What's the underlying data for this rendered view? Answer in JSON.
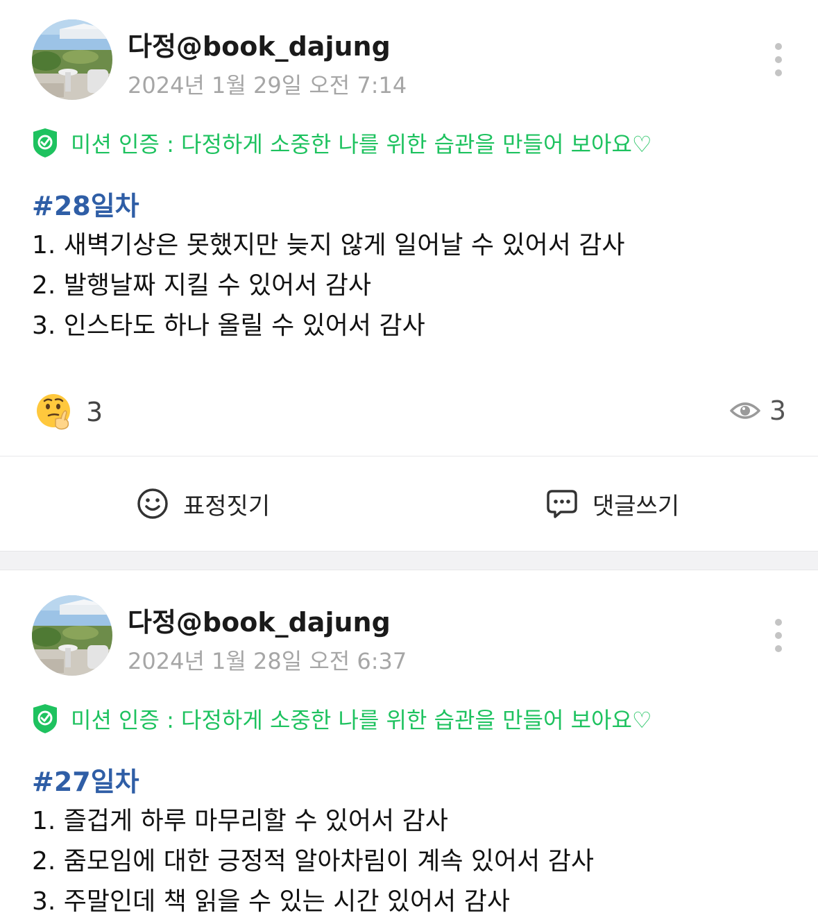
{
  "posts": [
    {
      "author": "다정@book_dajung",
      "date": "2024년 1월 29일 오전 7:14",
      "mission": "미션 인증 : 다정하게 소중한 나를 위한 습관을 만들어 보아요♡",
      "day_tag": "#28일차",
      "lines": [
        "1. 새벽기상은 못했지만 늦지 않게 일어날 수 있어서 감사",
        "2. 발행날짜 지킬 수 있어서 감사",
        "3. 인스타도 하나 올릴 수 있어서 감사"
      ],
      "reaction_count": "3",
      "view_count": "3",
      "actions": {
        "react_label": "표정짓기",
        "comment_label": "댓글쓰기"
      }
    },
    {
      "author": "다정@book_dajung",
      "date": "2024년 1월 28일 오전 6:37",
      "mission": "미션 인증 : 다정하게 소중한 나를 위한 습관을 만들어 보아요♡",
      "day_tag": "#27일차",
      "lines": [
        "1. 즐겁게 하루 마무리할 수 있어서 감사",
        "2. 줌모임에 대한 긍정적 알아차림이 계속 있어서 감사",
        "3. 주말인데 책 읽을 수 있는 시간 있어서 감사"
      ]
    }
  ],
  "colors": {
    "mission_green": "#1ec25f",
    "tag_blue": "#2f5ea6",
    "date_gray": "#a6a6a6"
  },
  "icons": [
    "avatar-photo",
    "kebab-more-icon",
    "shield-check-icon",
    "thinking-face-emoji-icon",
    "eye-icon",
    "smiley-icon",
    "speech-bubble-icon"
  ]
}
